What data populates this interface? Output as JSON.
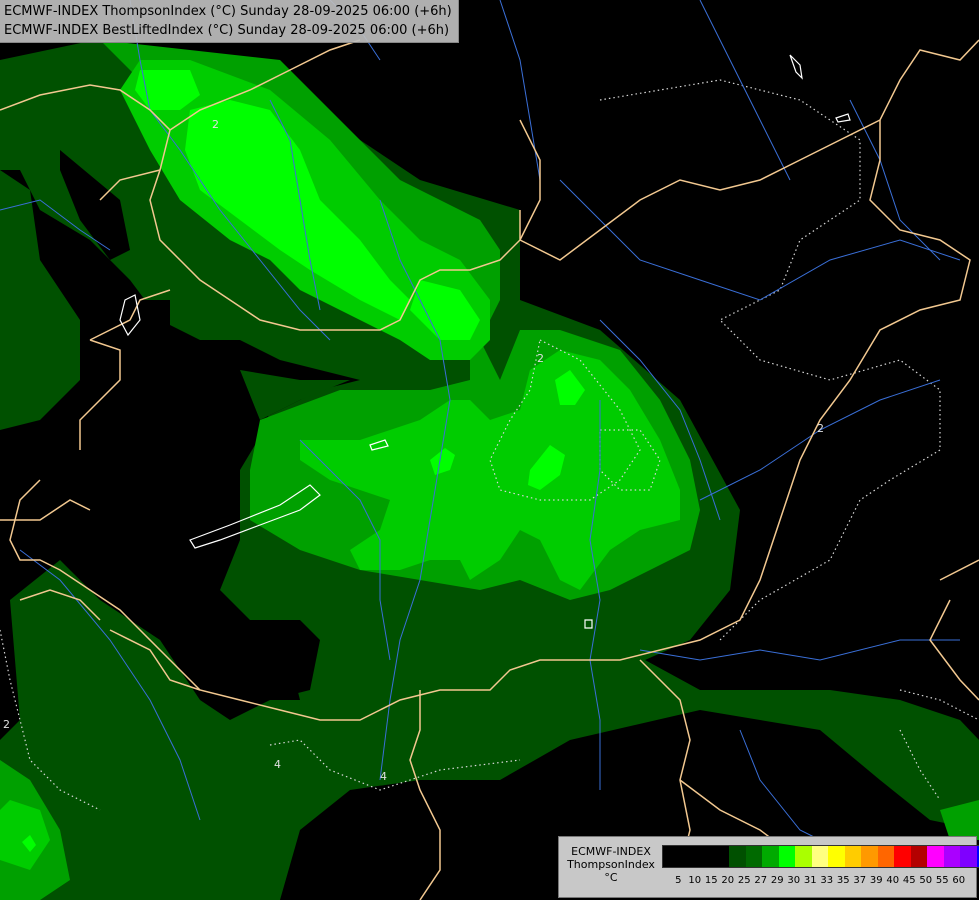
{
  "header": {
    "title_line_1": "ECMWF-INDEX ThompsonIndex (°C) Sunday 28-09-2025 06:00 (+6h)",
    "title_line_2": "ECMWF-INDEX BestLiftedIndex (°C) Sunday 28-09-2025 06:00 (+6h)"
  },
  "contour_labels": [
    "2",
    "2",
    "2",
    "2",
    "4",
    "4"
  ],
  "legend": {
    "line_1": "ECMWF-INDEX",
    "line_2": "ThompsonIndex",
    "line_3": "°C",
    "ticks": [
      "5",
      "10",
      "15",
      "20",
      "25",
      "27",
      "29",
      "30",
      "31",
      "33",
      "35",
      "37",
      "39",
      "40",
      "45",
      "50",
      "55",
      "60"
    ],
    "colors": [
      "#000000",
      "#000000",
      "#000000",
      "#000000",
      "#005000",
      "#006a00",
      "#00aa00",
      "#00ff00",
      "#aaff00",
      "#ffff80",
      "#ffff00",
      "#ffcc00",
      "#ff9900",
      "#ff6600",
      "#ff0000",
      "#b40000",
      "#ff00ff",
      "#aa00ff",
      "#7f00ff",
      "#0000ff"
    ]
  },
  "colors": {
    "green_dark": "#004d00",
    "green_mid": "#009a00",
    "green_light": "#00d800",
    "green_bright": "#00ff00",
    "border": "#f2c890",
    "river": "#3a6fd8"
  }
}
